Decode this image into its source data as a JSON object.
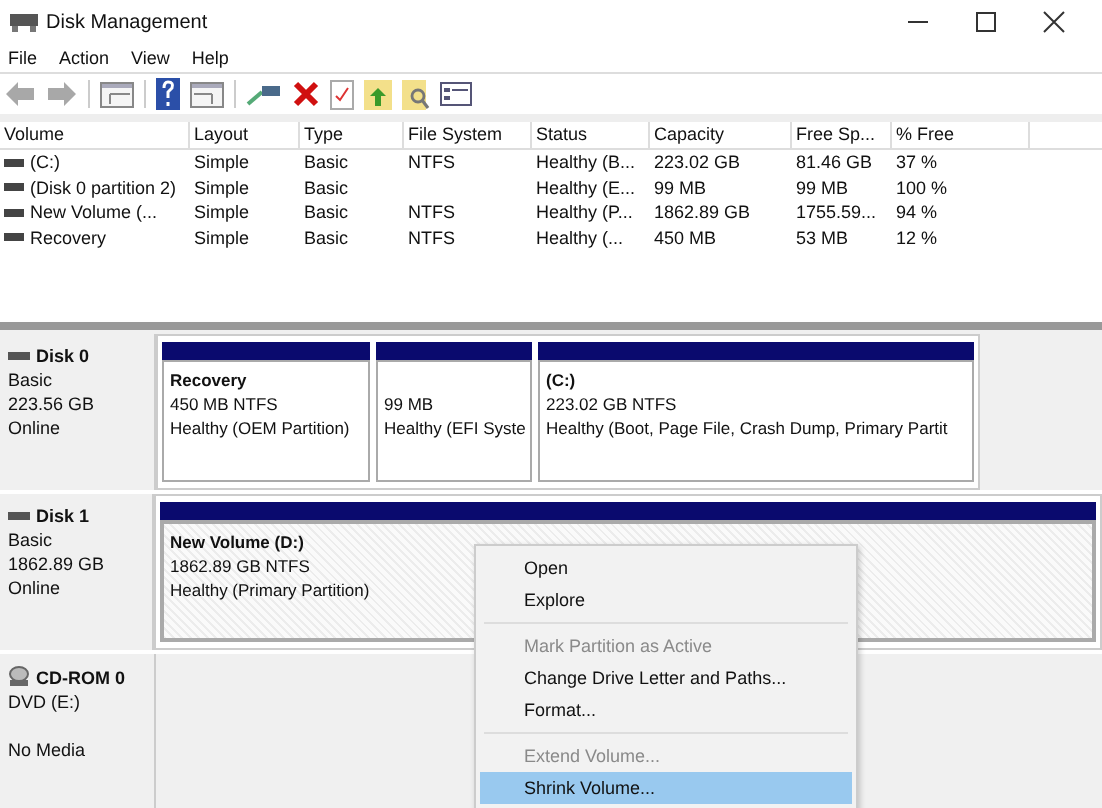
{
  "window": {
    "title": "Disk Management"
  },
  "menu": [
    "File",
    "Action",
    "View",
    "Help"
  ],
  "toolbar": [
    {
      "kind": "back",
      "disabled": true
    },
    {
      "kind": "forward",
      "disabled": true
    },
    {
      "kind": "sep"
    },
    {
      "kind": "panel"
    },
    {
      "kind": "sep"
    },
    {
      "kind": "help"
    },
    {
      "kind": "panel2"
    },
    {
      "kind": "sep"
    },
    {
      "kind": "connect"
    },
    {
      "kind": "delete"
    },
    {
      "kind": "check"
    },
    {
      "kind": "folderup"
    },
    {
      "kind": "search"
    },
    {
      "kind": "list"
    }
  ],
  "table": {
    "columns": [
      "Volume",
      "Layout",
      "Type",
      "File System",
      "Status",
      "Capacity",
      "Free Sp...",
      "% Free"
    ],
    "rows": [
      [
        "(C:)",
        "Simple",
        "Basic",
        "NTFS",
        "Healthy (B...",
        "223.02 GB",
        "81.46 GB",
        "37 %"
      ],
      [
        "(Disk 0 partition 2)",
        "Simple",
        "Basic",
        "",
        "Healthy (E...",
        "99 MB",
        "99 MB",
        "100 %"
      ],
      [
        "New Volume (...",
        "Simple",
        "Basic",
        "NTFS",
        "Healthy (P...",
        "1862.89 GB",
        "1755.59...",
        "94 %"
      ],
      [
        "Recovery",
        "Simple",
        "Basic",
        "NTFS",
        "Healthy (...",
        "450 MB",
        "53 MB",
        "12 %"
      ]
    ]
  },
  "disks": [
    {
      "kind": "disk",
      "name": "Disk 0",
      "type": "Basic",
      "size": "223.56 GB",
      "status": "Online",
      "partitions": [
        {
          "name": "Recovery",
          "size": "450 MB NTFS",
          "status": "Healthy (OEM Partition)",
          "selected": false
        },
        {
          "size": "99 MB",
          "status": "Healthy (EFI Syste",
          "selected": false
        },
        {
          "name": "(C:)",
          "size": "223.02 GB NTFS",
          "status": "Healthy (Boot, Page File, Crash Dump, Primary Partit",
          "selected": false
        }
      ]
    },
    {
      "kind": "disk",
      "name": "Disk 1",
      "type": "Basic",
      "size": "1862.89 GB",
      "status": "Online",
      "partitions": [
        {
          "name": "New Volume  (D:)",
          "size": "1862.89 GB NTFS",
          "status": "Healthy (Primary Partition)",
          "selected": true
        }
      ]
    },
    {
      "kind": "cdrom",
      "name": "CD-ROM 0",
      "type": "DVD (E:)",
      "status": "No Media"
    }
  ],
  "context_menu": [
    {
      "label": "Open",
      "disabled": false,
      "selected": false
    },
    {
      "label": "Explore",
      "disabled": false,
      "selected": false
    },
    {
      "kind": "sep"
    },
    {
      "label": "Mark Partition as Active",
      "disabled": true,
      "selected": false
    },
    {
      "label": "Change Drive Letter and Paths...",
      "disabled": false,
      "selected": false
    },
    {
      "label": "Format...",
      "disabled": false,
      "selected": false
    },
    {
      "kind": "sep"
    },
    {
      "label": "Extend Volume...",
      "disabled": true,
      "selected": false
    },
    {
      "label": "Shrink Volume...",
      "disabled": false,
      "selected": true
    }
  ]
}
